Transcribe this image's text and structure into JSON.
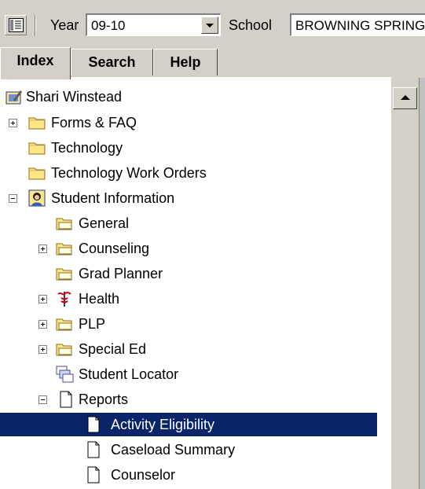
{
  "toolbar": {
    "year_label": "Year",
    "year_value": "09-10",
    "school_label": "School",
    "school_value": "BROWNING SPRINGS"
  },
  "tabs": [
    {
      "label": "Index",
      "active": true
    },
    {
      "label": "Search",
      "active": false
    },
    {
      "label": "Help",
      "active": false
    }
  ],
  "tree": [
    {
      "label": "Shari Winstead",
      "icon": "user-card-icon",
      "expander": "none",
      "selected": false
    },
    {
      "label": "Forms & FAQ",
      "icon": "folder-icon",
      "expander": "plus",
      "selected": false
    },
    {
      "label": "Technology",
      "icon": "folder-icon",
      "expander": "none",
      "selected": false
    },
    {
      "label": "Technology Work Orders",
      "icon": "folder-icon",
      "expander": "none",
      "selected": false
    },
    {
      "label": "Student Information",
      "icon": "student-icon",
      "expander": "minus",
      "selected": false
    },
    {
      "label": "General",
      "icon": "open-folder-icon",
      "expander": "none",
      "selected": false
    },
    {
      "label": "Counseling",
      "icon": "open-folder-icon",
      "expander": "plus",
      "selected": false
    },
    {
      "label": "Grad Planner",
      "icon": "open-folder-icon",
      "expander": "none",
      "selected": false
    },
    {
      "label": "Health",
      "icon": "caduceus-icon",
      "expander": "plus",
      "selected": false
    },
    {
      "label": "PLP",
      "icon": "open-folder-icon",
      "expander": "plus",
      "selected": false
    },
    {
      "label": "Special Ed",
      "icon": "open-folder-icon",
      "expander": "plus",
      "selected": false
    },
    {
      "label": "Student Locator",
      "icon": "locator-icon",
      "expander": "none",
      "selected": false
    },
    {
      "label": "Reports",
      "icon": "document-icon",
      "expander": "minus",
      "selected": false
    },
    {
      "label": "Activity Eligibility",
      "icon": "document-icon",
      "expander": "none",
      "selected": true
    },
    {
      "label": "Caseload Summary",
      "icon": "document-icon",
      "expander": "none",
      "selected": false
    },
    {
      "label": "Counselor",
      "icon": "document-icon",
      "expander": "none",
      "selected": false
    }
  ],
  "colors": {
    "selection": "#0a246a",
    "folder": "#fde68a",
    "chrome": "#d4d0c8"
  }
}
